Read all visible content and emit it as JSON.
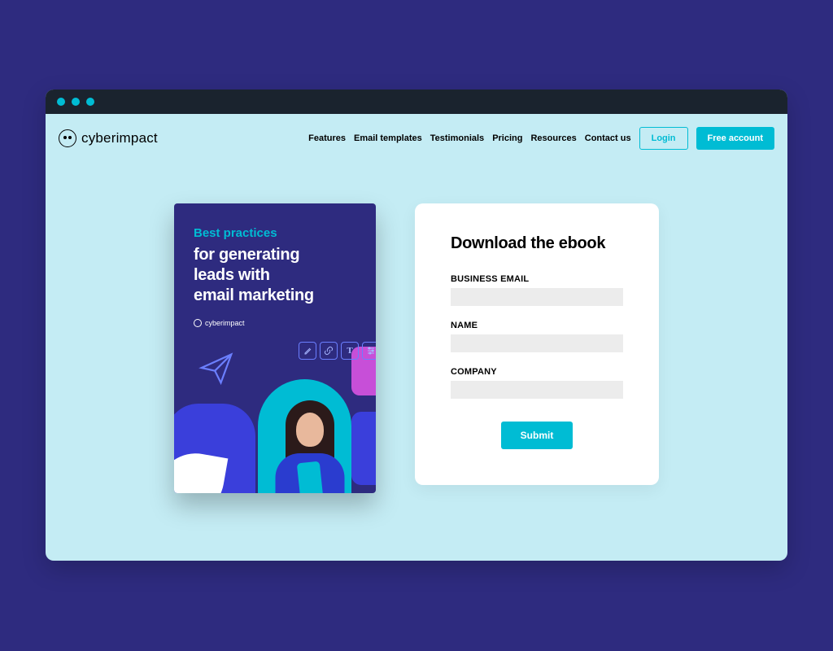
{
  "logo": {
    "text": "cyberimpact"
  },
  "nav": {
    "items": [
      "Features",
      "Email templates",
      "Testimonials",
      "Pricing",
      "Resources",
      "Contact us"
    ],
    "login_label": "Login",
    "free_account_label": "Free account"
  },
  "ebook": {
    "tagline": "Best practices",
    "title_line1": "for generating",
    "title_line2": "leads with",
    "title_line3": "email marketing",
    "brand": "cyberimpact",
    "tool_icons": [
      "eyedropper",
      "link",
      "text",
      "sliders"
    ]
  },
  "form": {
    "title": "Download the ebook",
    "fields": {
      "email": {
        "label": "BUSINESS EMAIL",
        "value": ""
      },
      "name": {
        "label": "NAME",
        "value": ""
      },
      "company": {
        "label": "COMPANY",
        "value": ""
      }
    },
    "submit_label": "Submit"
  },
  "colors": {
    "bg": "#2e2b7f",
    "accent": "#00bcd4",
    "page": "#c4ecf4"
  }
}
